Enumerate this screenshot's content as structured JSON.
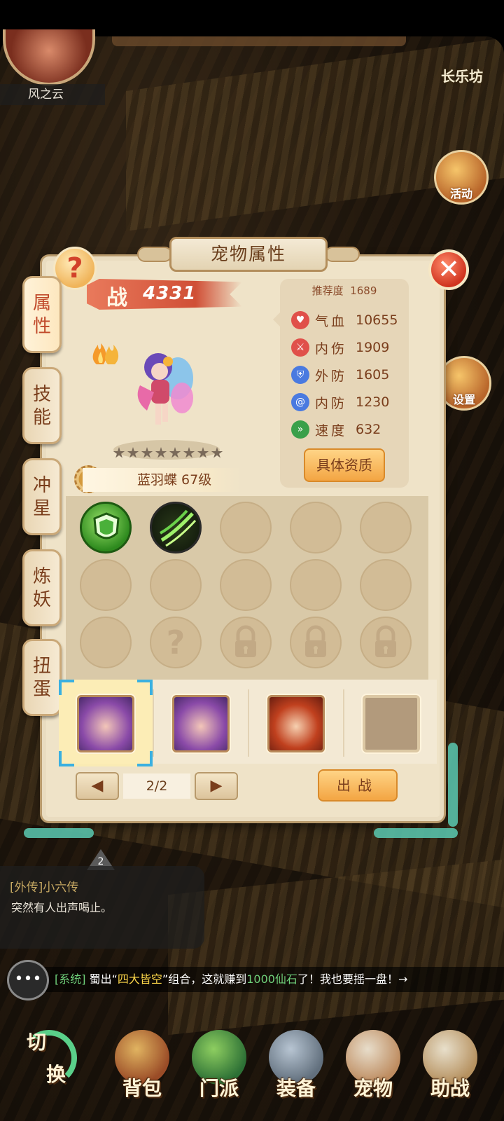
{
  "hud": {
    "player_name": "风之云",
    "location_title": "长乐坊",
    "side_buttons": [
      {
        "label": "活动",
        "icon": "lantern-icon"
      },
      {
        "label": "设置",
        "icon": "gear-icon"
      }
    ]
  },
  "panel": {
    "title": "宠物属性",
    "help_label": "?",
    "close_label": "✕",
    "tabs": [
      {
        "label_1": "属",
        "label_2": "性",
        "active": true
      },
      {
        "label_1": "技",
        "label_2": "能",
        "active": false
      },
      {
        "label_1": "冲",
        "label_2": "星",
        "active": false
      },
      {
        "label_1": "炼",
        "label_2": "妖",
        "active": false
      },
      {
        "label_1": "扭",
        "label_2": "蛋",
        "active": false
      }
    ],
    "power_prefix": "战",
    "power_value": "4331",
    "star_count": 8,
    "pet_name": "蓝羽蝶 67级",
    "stats": {
      "recommend_label": "推荐度",
      "recommend_value": "1689",
      "rows": [
        {
          "icon": "heart-icon",
          "label": "气血",
          "value": "10655",
          "color": "#e0504a"
        },
        {
          "icon": "sword-icon",
          "label": "内伤",
          "value": "1909",
          "color": "#e0504a"
        },
        {
          "icon": "shield-icon",
          "label": "外防",
          "value": "1605",
          "color": "#4a7ae0"
        },
        {
          "icon": "swirl-icon",
          "label": "内防",
          "value": "1230",
          "color": "#4a7ae0"
        },
        {
          "icon": "boot-icon",
          "label": "速度",
          "value": "632",
          "color": "#3aa04a"
        }
      ],
      "detail_button": "具体资质"
    },
    "skills": {
      "slots": [
        {
          "type": "skill",
          "icon": "shield-skill-icon"
        },
        {
          "type": "skill",
          "icon": "wind-slash-skill-icon"
        },
        {
          "type": "empty"
        },
        {
          "type": "empty"
        },
        {
          "type": "empty"
        },
        {
          "type": "empty"
        },
        {
          "type": "empty"
        },
        {
          "type": "empty"
        },
        {
          "type": "empty"
        },
        {
          "type": "empty"
        },
        {
          "type": "empty"
        },
        {
          "type": "unknown",
          "label": "?"
        },
        {
          "type": "locked"
        },
        {
          "type": "locked"
        },
        {
          "type": "locked"
        }
      ]
    },
    "pets": [
      {
        "name": "purple-hair-pet-1",
        "selected": true
      },
      {
        "name": "purple-hair-pet-2",
        "selected": false
      },
      {
        "name": "warrior-pet",
        "selected": false
      },
      {
        "name": "empty-slot",
        "selected": false
      }
    ],
    "pager": {
      "prev": "◀",
      "page": "2/2",
      "next": "▶"
    },
    "fight_button": "出战"
  },
  "quest": {
    "badge": "2",
    "title": "[外传]小六传",
    "description": "突然有人出声喝止。"
  },
  "chat": {
    "icon": "•••",
    "system_tag": "[系统]",
    "text_1": "蜀出“",
    "highlight_1": "四大皆空",
    "text_2": "”组合，这就赚到",
    "highlight_2": "1000仙石",
    "text_3": "了！我也要摇一盘！→"
  },
  "bottom_nav": {
    "switch_label_1": "切",
    "switch_label_2": "换",
    "items": [
      {
        "label": "背包",
        "icon": "bag-icon"
      },
      {
        "label": "门派",
        "icon": "sect-icon"
      },
      {
        "label": "装备",
        "icon": "sword-icon"
      },
      {
        "label": "宠物",
        "icon": "cat-icon"
      },
      {
        "label": "助战",
        "icon": "chef-icon"
      }
    ]
  }
}
